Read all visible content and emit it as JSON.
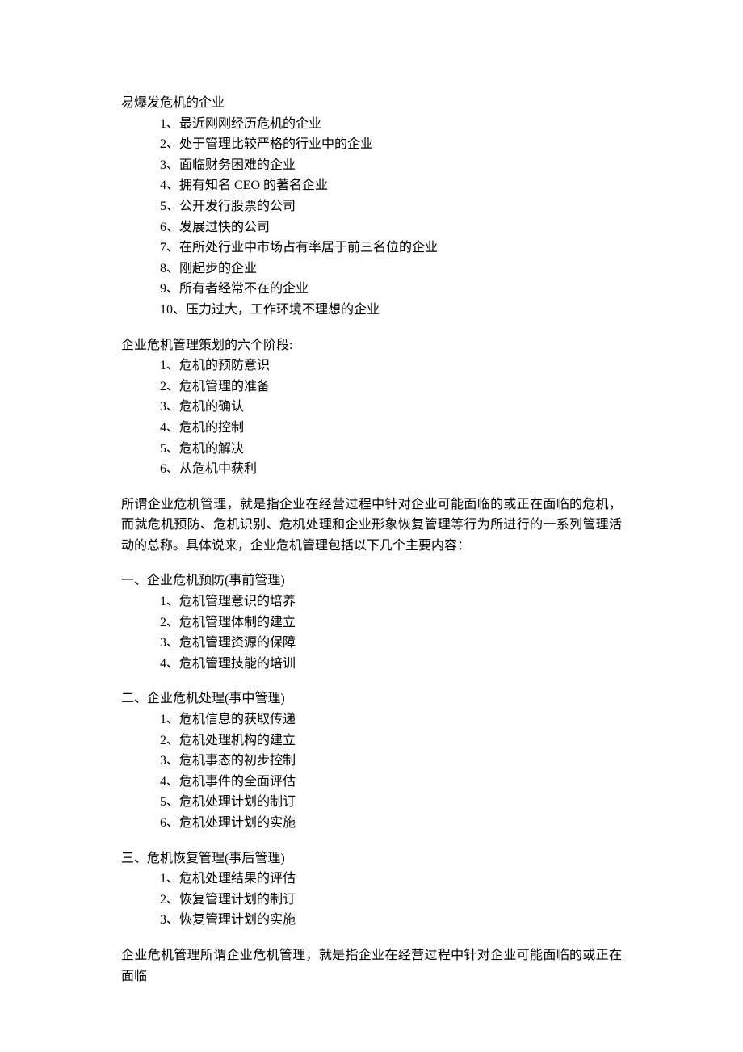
{
  "section1": {
    "title": "易爆发危机的企业",
    "items": [
      "1、最近刚刚经历危机的企业",
      "2、处于管理比较严格的行业中的企业",
      "3、面临财务困难的企业",
      "4、拥有知名 CEO 的著名企业",
      "5、公开发行股票的公司",
      "6、发展过快的公司",
      "7、在所处行业中市场占有率居于前三名位的企业",
      "8、刚起步的企业",
      "9、所有者经常不在的企业",
      "10、压力过大，工作环境不理想的企业"
    ]
  },
  "section2": {
    "title": "企业危机管理策划的六个阶段:",
    "items": [
      "1、危机的预防意识",
      "2、危机管理的准备",
      "3、危机的确认",
      "4、危机的控制",
      "5、危机的解决",
      "6、从危机中获利"
    ]
  },
  "para1": "所谓企业危机管理，就是指企业在经营过程中针对企业可能面临的或正在面临的危机，而就危机预防、危机识别、危机处理和企业形象恢复管理等行为所进行的一系列管理活动的总称。具体说来，企业危机管理包括以下几个主要内容：",
  "section3": {
    "title": "一、企业危机预防(事前管理)",
    "items": [
      "1、危机管理意识的培养",
      "2、危机管理体制的建立",
      "3、危机管理资源的保障",
      "4、危机管理技能的培训"
    ]
  },
  "section4": {
    "title": "二、企业危机处理(事中管理)",
    "items": [
      "1、危机信息的获取传递",
      "2、危机处理机构的建立",
      "3、危机事态的初步控制",
      "4、危机事件的全面评估",
      "5、危机处理计划的制订",
      "6、危机处理计划的实施"
    ]
  },
  "section5": {
    "title": "三、危机恢复管理(事后管理)",
    "items": [
      "1、危机处理结果的评估",
      "2、恢复管理计划的制订",
      "3、恢复管理计划的实施"
    ]
  },
  "para2": "企业危机管理所谓企业危机管理，就是指企业在经营过程中针对企业可能面临的或正在面临"
}
